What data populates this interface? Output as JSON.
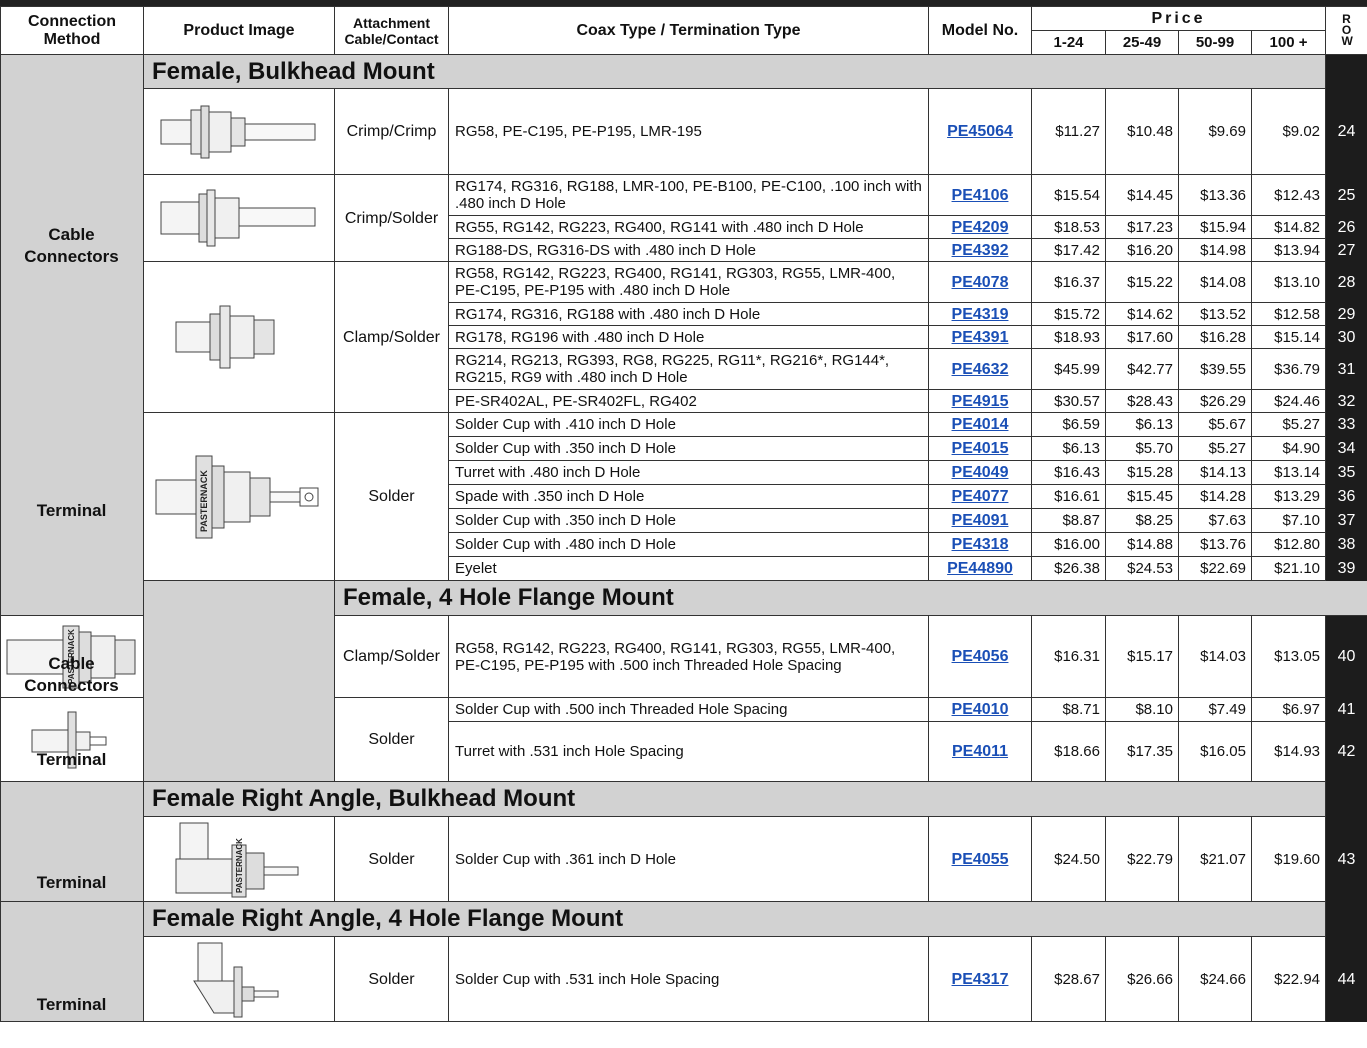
{
  "header": {
    "connection_method": "Connection Method",
    "product_image": "Product Image",
    "attachment": "Attachment Cable/Contact",
    "coax_type": "Coax Type / Termination Type",
    "model_no": "Model No.",
    "price": "Price",
    "qty": [
      "1-24",
      "25-49",
      "50-99",
      "100 +"
    ],
    "row": "ROW"
  },
  "sections": [
    {
      "title": "Female, Bulkhead Mount",
      "groups": [
        {
          "method": "Cable Connectors"
        },
        {
          "method": "Terminal"
        }
      ]
    },
    {
      "title": "Female, 4 Hole Flange Mount",
      "groups": [
        {
          "method": "Cable Connectors"
        },
        {
          "method": "Terminal"
        }
      ]
    },
    {
      "title": "Female Right Angle, Bulkhead Mount",
      "groups": [
        {
          "method": "Terminal"
        }
      ]
    },
    {
      "title": "Female Right Angle, 4 Hole Flange Mount",
      "groups": [
        {
          "method": "Terminal"
        }
      ]
    }
  ],
  "attachments": {
    "crimp_crimp": "Crimp/Crimp",
    "crimp_solder": "Crimp/Solder",
    "clamp_solder": "Clamp/Solder",
    "solder": "Solder"
  },
  "image_label": "PASTERNACK",
  "rows": [
    {
      "desc": "RG58, PE-C195, PE-P195, LMR-195",
      "model": "PE45064",
      "p1": "$11.27",
      "p2": "$10.48",
      "p3": "$9.69",
      "p4": "$9.02",
      "row": "24"
    },
    {
      "desc": "RG174, RG316, RG188, LMR-100, PE-B100, PE-C100, .100 inch with .480 inch D Hole",
      "model": "PE4106",
      "p1": "$15.54",
      "p2": "$14.45",
      "p3": "$13.36",
      "p4": "$12.43",
      "row": "25"
    },
    {
      "desc": "RG55, RG142, RG223, RG400, RG141 with .480 inch D Hole",
      "model": "PE4209",
      "p1": "$18.53",
      "p2": "$17.23",
      "p3": "$15.94",
      "p4": "$14.82",
      "row": "26"
    },
    {
      "desc": "RG188-DS, RG316-DS with .480 inch D Hole",
      "model": "PE4392",
      "p1": "$17.42",
      "p2": "$16.20",
      "p3": "$14.98",
      "p4": "$13.94",
      "row": "27"
    },
    {
      "desc": "RG58, RG142, RG223, RG400, RG141, RG303, RG55, LMR-400, PE-C195, PE-P195 with .480 inch D Hole",
      "model": "PE4078",
      "p1": "$16.37",
      "p2": "$15.22",
      "p3": "$14.08",
      "p4": "$13.10",
      "row": "28"
    },
    {
      "desc": "RG174, RG316, RG188 with .480 inch D Hole",
      "model": "PE4319",
      "p1": "$15.72",
      "p2": "$14.62",
      "p3": "$13.52",
      "p4": "$12.58",
      "row": "29"
    },
    {
      "desc": "RG178, RG196 with .480 inch D Hole",
      "model": "PE4391",
      "p1": "$18.93",
      "p2": "$17.60",
      "p3": "$16.28",
      "p4": "$15.14",
      "row": "30"
    },
    {
      "desc": "RG214, RG213, RG393, RG8, RG225, RG11*, RG216*, RG144*, RG215, RG9 with .480 inch D Hole",
      "model": "PE4632",
      "p1": "$45.99",
      "p2": "$42.77",
      "p3": "$39.55",
      "p4": "$36.79",
      "row": "31"
    },
    {
      "desc": "PE-SR402AL, PE-SR402FL, RG402",
      "model": "PE4915",
      "p1": "$30.57",
      "p2": "$28.43",
      "p3": "$26.29",
      "p4": "$24.46",
      "row": "32"
    },
    {
      "desc": "Solder Cup with .410 inch D Hole",
      "model": "PE4014",
      "p1": "$6.59",
      "p2": "$6.13",
      "p3": "$5.67",
      "p4": "$5.27",
      "row": "33"
    },
    {
      "desc": "Solder Cup with .350 inch D Hole",
      "model": "PE4015",
      "p1": "$6.13",
      "p2": "$5.70",
      "p3": "$5.27",
      "p4": "$4.90",
      "row": "34"
    },
    {
      "desc": "Turret with .480 inch D Hole",
      "model": "PE4049",
      "p1": "$16.43",
      "p2": "$15.28",
      "p3": "$14.13",
      "p4": "$13.14",
      "row": "35"
    },
    {
      "desc": "Spade with .350 inch D Hole",
      "model": "PE4077",
      "p1": "$16.61",
      "p2": "$15.45",
      "p3": "$14.28",
      "p4": "$13.29",
      "row": "36"
    },
    {
      "desc": "Solder Cup with .350 inch D Hole",
      "model": "PE4091",
      "p1": "$8.87",
      "p2": "$8.25",
      "p3": "$7.63",
      "p4": "$7.10",
      "row": "37"
    },
    {
      "desc": "Solder Cup with .480 inch D Hole",
      "model": "PE4318",
      "p1": "$16.00",
      "p2": "$14.88",
      "p3": "$13.76",
      "p4": "$12.80",
      "row": "38"
    },
    {
      "desc": "Eyelet",
      "model": "PE44890",
      "p1": "$26.38",
      "p2": "$24.53",
      "p3": "$22.69",
      "p4": "$21.10",
      "row": "39"
    },
    {
      "desc": "RG58, RG142, RG223, RG400, RG141, RG303, RG55, LMR-400, PE-C195, PE-P195 with .500 inch Threaded Hole Spacing",
      "model": "PE4056",
      "p1": "$16.31",
      "p2": "$15.17",
      "p3": "$14.03",
      "p4": "$13.05",
      "row": "40"
    },
    {
      "desc": "Solder Cup with .500 inch Threaded Hole Spacing",
      "model": "PE4010",
      "p1": "$8.71",
      "p2": "$8.10",
      "p3": "$7.49",
      "p4": "$6.97",
      "row": "41"
    },
    {
      "desc": "Turret with .531 inch Hole Spacing",
      "model": "PE4011",
      "p1": "$18.66",
      "p2": "$17.35",
      "p3": "$16.05",
      "p4": "$14.93",
      "row": "42"
    },
    {
      "desc": "Solder Cup with .361 inch D Hole",
      "model": "PE4055",
      "p1": "$24.50",
      "p2": "$22.79",
      "p3": "$21.07",
      "p4": "$19.60",
      "row": "43"
    },
    {
      "desc": "Solder Cup with .531 inch Hole Spacing",
      "model": "PE4317",
      "p1": "$28.67",
      "p2": "$26.66",
      "p3": "$24.66",
      "p4": "$22.94",
      "row": "44"
    }
  ]
}
